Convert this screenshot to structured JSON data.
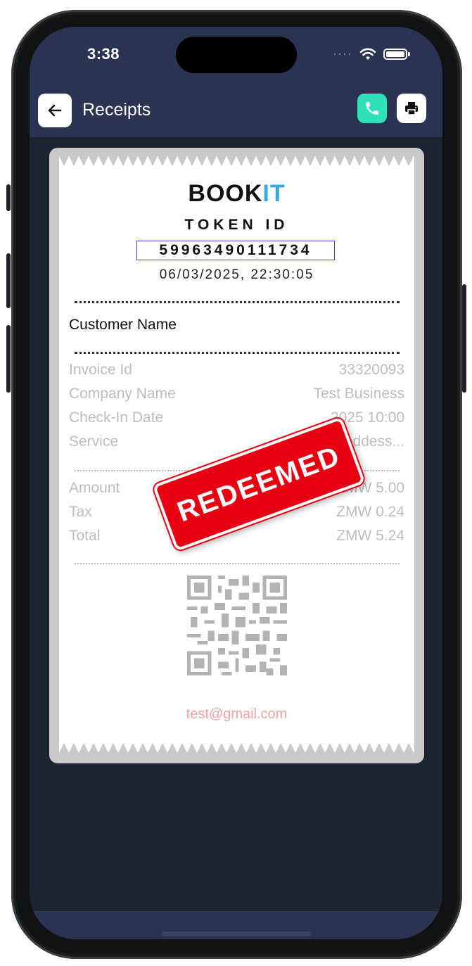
{
  "status_bar": {
    "time": "3:38",
    "signal": "····"
  },
  "header": {
    "title": "Receipts"
  },
  "receipt": {
    "logo_main": "BOOK",
    "logo_accent": "IT",
    "token_label": "TOKEN ID",
    "token_id": "59963490111734",
    "datetime": "06/03/2025, 22:30:05",
    "customer_name": "Customer Name",
    "details": [
      {
        "label": "Invoice Id",
        "value": "33320093"
      },
      {
        "label": "Company Name",
        "value": "Test Business"
      },
      {
        "label": "Check-In Date",
        "value": "2025 10:00"
      },
      {
        "label": "Service",
        "value": "Goddess..."
      }
    ],
    "totals": [
      {
        "label": "Amount",
        "value": "ZMW 5.00"
      },
      {
        "label": "Tax",
        "value": "ZMW 0.24"
      },
      {
        "label": "Total",
        "value": "ZMW 5.24"
      }
    ],
    "email": "test@gmail.com",
    "stamp": "REDEEMED"
  },
  "icons": {
    "back": "arrow-left-icon",
    "call": "phone-icon",
    "print": "printer-icon",
    "wifi": "wifi-icon",
    "battery": "battery-icon"
  },
  "colors": {
    "header_bg": "#2a3452",
    "screen_bg": "#1c2331",
    "call_button": "#2de2b8",
    "stamp_red": "#e60012",
    "logo_accent": "#39a8e0"
  }
}
